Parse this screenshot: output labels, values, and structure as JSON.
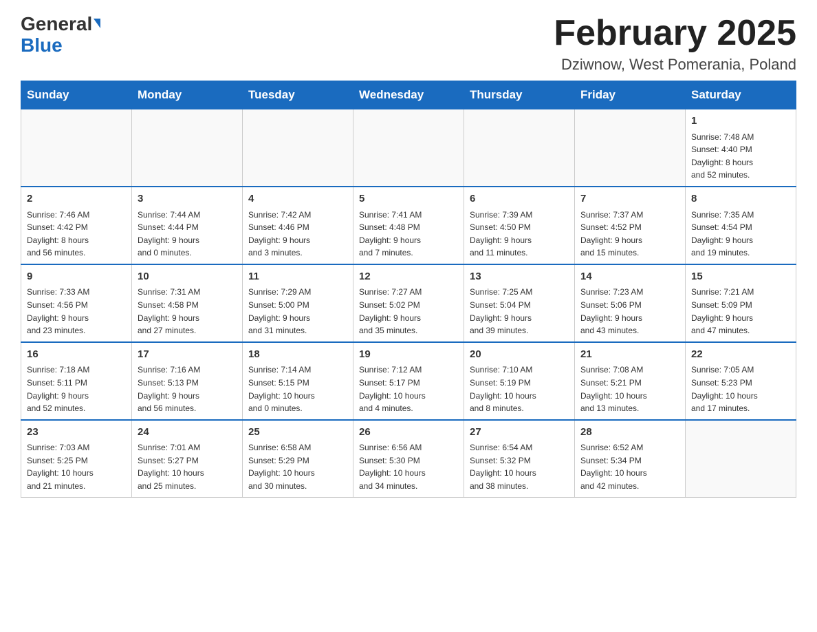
{
  "header": {
    "logo_general": "General",
    "logo_blue": "Blue",
    "title": "February 2025",
    "subtitle": "Dziwnow, West Pomerania, Poland"
  },
  "weekdays": [
    "Sunday",
    "Monday",
    "Tuesday",
    "Wednesday",
    "Thursday",
    "Friday",
    "Saturday"
  ],
  "weeks": [
    [
      {
        "day": "",
        "info": ""
      },
      {
        "day": "",
        "info": ""
      },
      {
        "day": "",
        "info": ""
      },
      {
        "day": "",
        "info": ""
      },
      {
        "day": "",
        "info": ""
      },
      {
        "day": "",
        "info": ""
      },
      {
        "day": "1",
        "info": "Sunrise: 7:48 AM\nSunset: 4:40 PM\nDaylight: 8 hours\nand 52 minutes."
      }
    ],
    [
      {
        "day": "2",
        "info": "Sunrise: 7:46 AM\nSunset: 4:42 PM\nDaylight: 8 hours\nand 56 minutes."
      },
      {
        "day": "3",
        "info": "Sunrise: 7:44 AM\nSunset: 4:44 PM\nDaylight: 9 hours\nand 0 minutes."
      },
      {
        "day": "4",
        "info": "Sunrise: 7:42 AM\nSunset: 4:46 PM\nDaylight: 9 hours\nand 3 minutes."
      },
      {
        "day": "5",
        "info": "Sunrise: 7:41 AM\nSunset: 4:48 PM\nDaylight: 9 hours\nand 7 minutes."
      },
      {
        "day": "6",
        "info": "Sunrise: 7:39 AM\nSunset: 4:50 PM\nDaylight: 9 hours\nand 11 minutes."
      },
      {
        "day": "7",
        "info": "Sunrise: 7:37 AM\nSunset: 4:52 PM\nDaylight: 9 hours\nand 15 minutes."
      },
      {
        "day": "8",
        "info": "Sunrise: 7:35 AM\nSunset: 4:54 PM\nDaylight: 9 hours\nand 19 minutes."
      }
    ],
    [
      {
        "day": "9",
        "info": "Sunrise: 7:33 AM\nSunset: 4:56 PM\nDaylight: 9 hours\nand 23 minutes."
      },
      {
        "day": "10",
        "info": "Sunrise: 7:31 AM\nSunset: 4:58 PM\nDaylight: 9 hours\nand 27 minutes."
      },
      {
        "day": "11",
        "info": "Sunrise: 7:29 AM\nSunset: 5:00 PM\nDaylight: 9 hours\nand 31 minutes."
      },
      {
        "day": "12",
        "info": "Sunrise: 7:27 AM\nSunset: 5:02 PM\nDaylight: 9 hours\nand 35 minutes."
      },
      {
        "day": "13",
        "info": "Sunrise: 7:25 AM\nSunset: 5:04 PM\nDaylight: 9 hours\nand 39 minutes."
      },
      {
        "day": "14",
        "info": "Sunrise: 7:23 AM\nSunset: 5:06 PM\nDaylight: 9 hours\nand 43 minutes."
      },
      {
        "day": "15",
        "info": "Sunrise: 7:21 AM\nSunset: 5:09 PM\nDaylight: 9 hours\nand 47 minutes."
      }
    ],
    [
      {
        "day": "16",
        "info": "Sunrise: 7:18 AM\nSunset: 5:11 PM\nDaylight: 9 hours\nand 52 minutes."
      },
      {
        "day": "17",
        "info": "Sunrise: 7:16 AM\nSunset: 5:13 PM\nDaylight: 9 hours\nand 56 minutes."
      },
      {
        "day": "18",
        "info": "Sunrise: 7:14 AM\nSunset: 5:15 PM\nDaylight: 10 hours\nand 0 minutes."
      },
      {
        "day": "19",
        "info": "Sunrise: 7:12 AM\nSunset: 5:17 PM\nDaylight: 10 hours\nand 4 minutes."
      },
      {
        "day": "20",
        "info": "Sunrise: 7:10 AM\nSunset: 5:19 PM\nDaylight: 10 hours\nand 8 minutes."
      },
      {
        "day": "21",
        "info": "Sunrise: 7:08 AM\nSunset: 5:21 PM\nDaylight: 10 hours\nand 13 minutes."
      },
      {
        "day": "22",
        "info": "Sunrise: 7:05 AM\nSunset: 5:23 PM\nDaylight: 10 hours\nand 17 minutes."
      }
    ],
    [
      {
        "day": "23",
        "info": "Sunrise: 7:03 AM\nSunset: 5:25 PM\nDaylight: 10 hours\nand 21 minutes."
      },
      {
        "day": "24",
        "info": "Sunrise: 7:01 AM\nSunset: 5:27 PM\nDaylight: 10 hours\nand 25 minutes."
      },
      {
        "day": "25",
        "info": "Sunrise: 6:58 AM\nSunset: 5:29 PM\nDaylight: 10 hours\nand 30 minutes."
      },
      {
        "day": "26",
        "info": "Sunrise: 6:56 AM\nSunset: 5:30 PM\nDaylight: 10 hours\nand 34 minutes."
      },
      {
        "day": "27",
        "info": "Sunrise: 6:54 AM\nSunset: 5:32 PM\nDaylight: 10 hours\nand 38 minutes."
      },
      {
        "day": "28",
        "info": "Sunrise: 6:52 AM\nSunset: 5:34 PM\nDaylight: 10 hours\nand 42 minutes."
      },
      {
        "day": "",
        "info": ""
      }
    ]
  ]
}
